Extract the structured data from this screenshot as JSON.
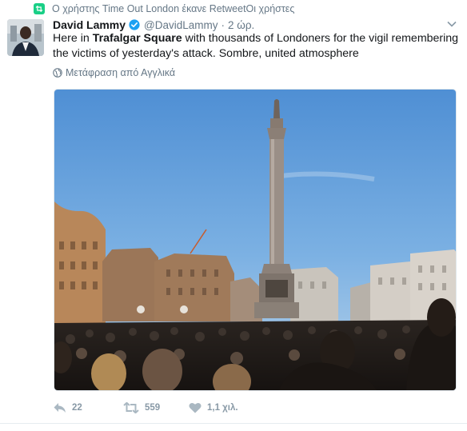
{
  "retweet_context": {
    "icon": "retweet-icon",
    "text": "Ο χρήστης Time Out London έκανε RetweetΟι χρήστες"
  },
  "tweet": {
    "fullname": "David Lammy",
    "verified": true,
    "username": "@DavidLammy",
    "separator": "·",
    "time": "2 ώρ.",
    "text_parts": {
      "p1": "Here in ",
      "bold": "Trafalgar Square",
      "p2": " with thousands of Londoners for the vigil remembering the victims of yesterday's attack. Sombre, united atmosphere"
    },
    "translate_label": "Μετάφραση από Αγγλικά",
    "media": {
      "alt": "Nelson's Column in Trafalgar Square with a large crowd at dusk",
      "sky_color": "#5d9bd8"
    },
    "actions": {
      "reply_count": "22",
      "retweet_count": "559",
      "like_count": "1,1 χιλ."
    }
  },
  "colors": {
    "accent_retweet": "#19cf86",
    "verified_blue": "#1da1f2",
    "muted": "#657786"
  }
}
